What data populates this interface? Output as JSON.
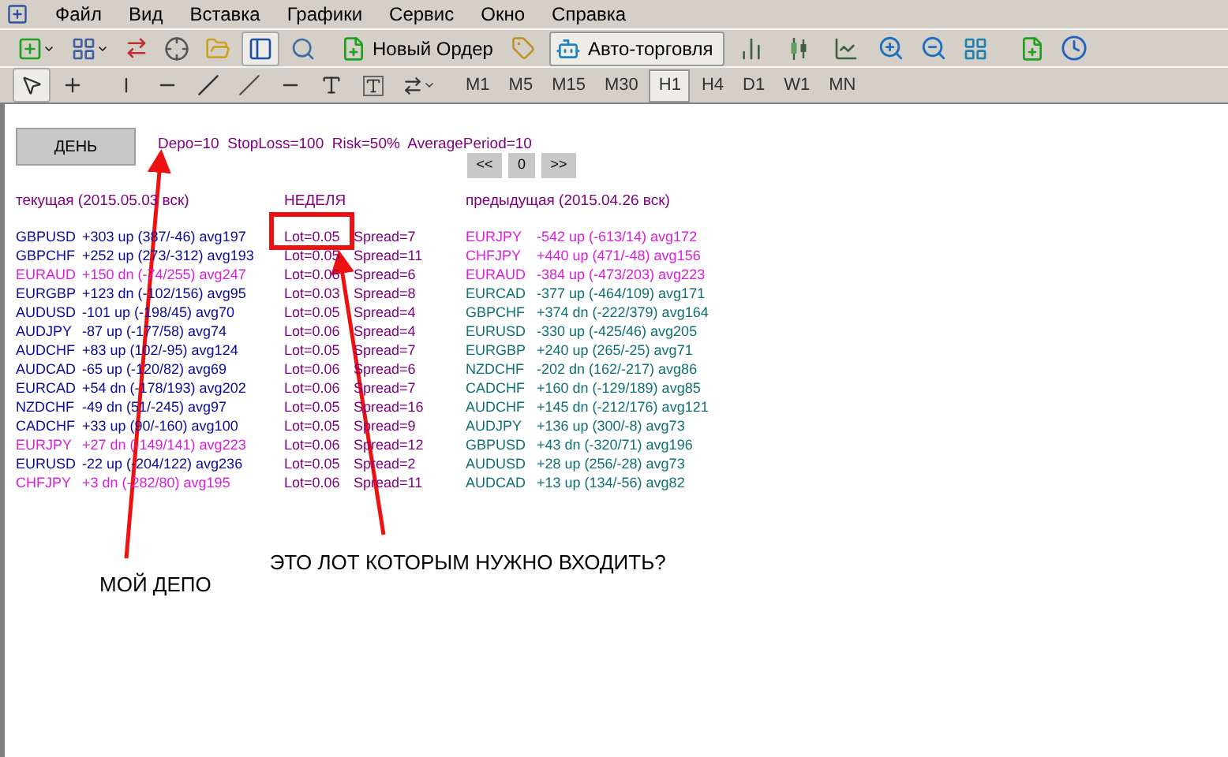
{
  "menu": [
    "Файл",
    "Вид",
    "Вставка",
    "Графики",
    "Сервис",
    "Окно",
    "Справка"
  ],
  "toolbar": {
    "new_order_button": "Новый Ордер",
    "auto_trading_button": {
      "label": "Авто-торговля",
      "on": true
    }
  },
  "drawing_tools": {
    "cursor_selected": true
  },
  "timeframes": [
    {
      "label": "M1",
      "selected": false
    },
    {
      "label": "M5",
      "selected": false
    },
    {
      "label": "M15",
      "selected": false
    },
    {
      "label": "M30",
      "selected": false
    },
    {
      "label": "H1",
      "selected": true
    },
    {
      "label": "H4",
      "selected": false
    },
    {
      "label": "D1",
      "selected": false
    },
    {
      "label": "W1",
      "selected": false
    },
    {
      "label": "MN",
      "selected": false
    }
  ],
  "chart": {
    "period_button": "ДЕНЬ",
    "parameters": "Depo=10  StopLoss=100  Risk=50%  AveragePeriod=10",
    "nav_buttons": [
      "<<",
      "0",
      ">>"
    ],
    "headers": [
      "текущая (2015.05.03 вск)",
      "НЕДЕЛЯ",
      "предыдущая (2015.04.26 вск)"
    ],
    "current": [
      {
        "pair": "GBPUSD",
        "stats": "+303 up (387/-46) avg197",
        "color": "#0a0a96"
      },
      {
        "pair": "GBPCHF",
        "stats": "+252 up (273/-312) avg193",
        "color": "#0a0a96"
      },
      {
        "pair": "EURAUD",
        "stats": "+150 dn (-74/255) avg247",
        "color": "#d81ed8"
      },
      {
        "pair": "EURGBP",
        "stats": "+123 dn (-102/156) avg95",
        "color": "#0a0a96"
      },
      {
        "pair": "AUDUSD",
        "stats": "-101 up (-198/45) avg70",
        "color": "#0a0a96"
      },
      {
        "pair": "AUDJPY",
        "stats": "-87 up (-177/58) avg74",
        "color": "#0a0a96"
      },
      {
        "pair": "AUDCHF",
        "stats": "+83 up (102/-95) avg124",
        "color": "#0a0a96"
      },
      {
        "pair": "AUDCAD",
        "stats": "-65 up (-120/82) avg69",
        "color": "#0a0a96"
      },
      {
        "pair": "EURCAD",
        "stats": "+54 dn (-178/193) avg202",
        "color": "#0a0a96"
      },
      {
        "pair": "NZDCHF",
        "stats": "-49 dn (51/-245) avg97",
        "color": "#0a0a96"
      },
      {
        "pair": "CADCHF",
        "stats": "+33 up (90/-160) avg100",
        "color": "#0a0a96"
      },
      {
        "pair": "EURJPY",
        "stats": "+27 dn (-149/141) avg223",
        "color": "#d81ed8"
      },
      {
        "pair": "EURUSD",
        "stats": "-22 up (-204/122) avg236",
        "color": "#0a0a96"
      },
      {
        "pair": "CHFJPY",
        "stats": "+3 dn (-282/80) avg195",
        "color": "#d81ed8"
      }
    ],
    "week": [
      {
        "lot": "Lot=0.05",
        "spread": "Spread=7"
      },
      {
        "lot": "Lot=0.05",
        "spread": "Spread=11"
      },
      {
        "lot": "Lot=0.06",
        "spread": "Spread=6"
      },
      {
        "lot": "Lot=0.03",
        "spread": "Spread=8"
      },
      {
        "lot": "Lot=0.05",
        "spread": "Spread=4"
      },
      {
        "lot": "Lot=0.06",
        "spread": "Spread=4"
      },
      {
        "lot": "Lot=0.05",
        "spread": "Spread=7"
      },
      {
        "lot": "Lot=0.06",
        "spread": "Spread=6"
      },
      {
        "lot": "Lot=0.06",
        "spread": "Spread=7"
      },
      {
        "lot": "Lot=0.05",
        "spread": "Spread=16"
      },
      {
        "lot": "Lot=0.05",
        "spread": "Spread=9"
      },
      {
        "lot": "Lot=0.06",
        "spread": "Spread=12"
      },
      {
        "lot": "Lot=0.05",
        "spread": "Spread=2"
      },
      {
        "lot": "Lot=0.06",
        "spread": "Spread=11"
      }
    ],
    "previous": [
      {
        "pair": "EURJPY",
        "stats": "-542 up (-613/14) avg172",
        "color": "#d81ed8"
      },
      {
        "pair": "CHFJPY",
        "stats": "+440 up (471/-48) avg156",
        "color": "#d81ed8"
      },
      {
        "pair": "EURAUD",
        "stats": "-384 up (-473/203) avg223",
        "color": "#d81ed8"
      },
      {
        "pair": "EURCAD",
        "stats": "-377 up (-464/109) avg171",
        "color": "#0f7070"
      },
      {
        "pair": "GBPCHF",
        "stats": "+374 dn (-222/379) avg164",
        "color": "#0f7070"
      },
      {
        "pair": "EURUSD",
        "stats": "-330 up (-425/46) avg205",
        "color": "#0f7070"
      },
      {
        "pair": "EURGBP",
        "stats": "+240 up (265/-25) avg71",
        "color": "#0f7070"
      },
      {
        "pair": "NZDCHF",
        "stats": "-202 dn (162/-217) avg86",
        "color": "#0f7070"
      },
      {
        "pair": "CADCHF",
        "stats": "+160 dn (-129/189) avg85",
        "color": "#0f7070"
      },
      {
        "pair": "AUDCHF",
        "stats": "+145 dn (-212/176) avg121",
        "color": "#0f7070"
      },
      {
        "pair": "AUDJPY",
        "stats": "+136 up (300/-8) avg73",
        "color": "#0f7070"
      },
      {
        "pair": "GBPUSD",
        "stats": "+43 dn (-320/71) avg196",
        "color": "#0f7070"
      },
      {
        "pair": "AUDUSD",
        "stats": "+28 up (256/-28) avg73",
        "color": "#0f7070"
      },
      {
        "pair": "AUDCAD",
        "stats": "+13 up (134/-56) avg82",
        "color": "#0f7070"
      }
    ]
  },
  "annotations": [
    "МОЙ ДЕПО",
    "ЭТО ЛОТ КОТОРЫМ НУЖНО ВХОДИТЬ?"
  ]
}
